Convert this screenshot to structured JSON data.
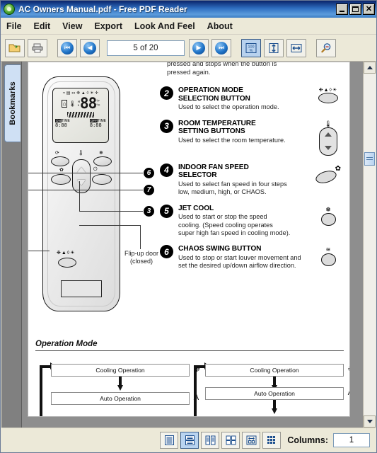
{
  "window": {
    "title": "AC Owners Manual.pdf - Free PDF Reader",
    "logo_icon": "app-logo-icon",
    "minimize_label": "_",
    "maximize_label": "□",
    "close_label": "✕"
  },
  "menu": {
    "items": [
      {
        "label": "File"
      },
      {
        "label": "Edit"
      },
      {
        "label": "View"
      },
      {
        "label": "Export"
      },
      {
        "label": "Look And Feel"
      },
      {
        "label": "About"
      }
    ]
  },
  "toolbar": {
    "open_icon": "open-folder-icon",
    "print_icon": "printer-icon",
    "first_page_icon": "first-page-icon",
    "prev_page_icon": "previous-page-icon",
    "next_page_icon": "next-page-icon",
    "last_page_icon": "last-page-icon",
    "page_indicator": "5 of 20",
    "zoom_100_label": "100%",
    "zoom_100_icon": "zoom-100-percent-icon",
    "fit_height_icon": "fit-page-height-icon",
    "fit_width_icon": "fit-page-width-icon",
    "zoom_out_icon": "zoom-out-magnifier-icon"
  },
  "sidebar": {
    "tab_label": "Bookmarks"
  },
  "statusbar": {
    "view_buttons": [
      {
        "name": "single-page-view",
        "selected": false
      },
      {
        "name": "continuous-page-view",
        "selected": true
      },
      {
        "name": "two-column-view",
        "selected": false
      },
      {
        "name": "four-up-view",
        "selected": false
      },
      {
        "name": "fit-view",
        "selected": false
      },
      {
        "name": "thumbnail-grid-view",
        "selected": false
      }
    ],
    "columns_label": "Columns:",
    "columns_value": "1"
  },
  "document": {
    "clipped_top_text": "pressed and stops when the button is\npressed again.",
    "items": [
      {
        "number": "2",
        "title": "OPERATION MODE\nSELECTION BUTTON",
        "desc": "Used to select the operation mode.",
        "glyphs": "❉▲◊☀",
        "control_icon": "oval-button-icon"
      },
      {
        "number": "3",
        "title": "ROOM TEMPERATURE\nSETTING BUTTONS",
        "desc": "Used to select the room temperature.",
        "glyphs": "",
        "control_icon": "up-down-temperature-buttons-icon"
      },
      {
        "number": "4",
        "title": "INDOOR FAN SPEED\nSELECTOR",
        "desc": "Used to select fan speed in four steps\nlow, medium, high, or CHAOS.",
        "glyphs": "",
        "control_icon": "fan-speed-button-icon"
      },
      {
        "number": "5",
        "title": "JET COOL",
        "desc": "Used to start or stop the speed\ncooling. (Speed cooling operates\nsuper high fan speed in cooling mode).",
        "glyphs": "",
        "control_icon": "jet-cool-button-icon"
      },
      {
        "number": "6",
        "title": "CHAOS SWING BUTTON",
        "desc": "Used to stop or start louver movement and\nset the desired up/down airflow direction.",
        "glyphs": "",
        "control_icon": "chaos-swing-button-icon"
      }
    ],
    "remote": {
      "lcd_top_glyphs": "≈ ▤ ⚏ ❉ ▲ ◊ ☀ ✛",
      "lcd_home_icon": "home-icon",
      "lcd_thermo_icon": "thermometer-icon",
      "lcd_digits": "88",
      "lcd_unit_f": "°F",
      "lcd_unit_c": "°C",
      "lcd_h_label": "H",
      "lcd_l_label": "L",
      "lcd_timer1_chip": "ON",
      "lcd_timer1_label": "TIME",
      "lcd_timer1_value": "8:88",
      "lcd_timer2_chip": "OFF",
      "lcd_timer2_label": "TIME",
      "lcd_timer2_value": "8:88",
      "mode_glyphs": "❉▲◊☀",
      "callouts": [
        "6",
        "7",
        "3"
      ],
      "flipdoor_note": "Flip-up door\n(closed)"
    },
    "operation_mode": {
      "title": "Operation Mode",
      "columns": [
        {
          "boxes": [
            {
              "label": "Cooling Operation",
              "symbol": "❉"
            },
            {
              "label": "Auto Operation",
              "symbol": "Ａ"
            }
          ]
        },
        {
          "boxes": [
            {
              "label": "Cooling Operation",
              "symbol": "❉"
            },
            {
              "label": "Auto Operation",
              "symbol": "Ａ"
            }
          ]
        }
      ]
    }
  }
}
